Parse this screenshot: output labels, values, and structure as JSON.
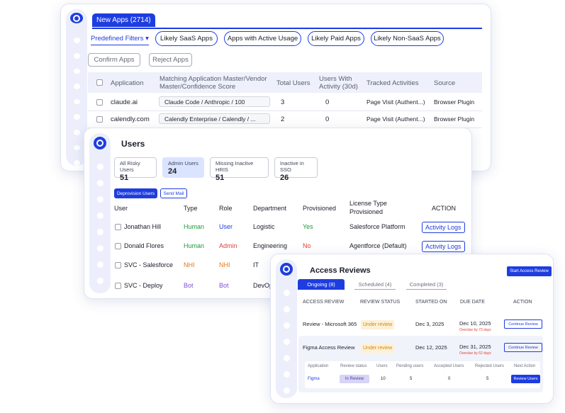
{
  "colors": {
    "accent": "#1e3de0",
    "human": "#1f9a3c",
    "nhi": "#e07b13",
    "bot": "#7d4fd8",
    "admin": "#e2413b",
    "user": "#1e3de0",
    "warning_bg": "#fdf0d6"
  },
  "apps": {
    "tab_label": "New Apps (2714)",
    "predefined_filters": "Predefined Filters ▾",
    "pills": [
      "Likely SaaS Apps",
      "Apps with Active Usage",
      "Likely Paid Apps",
      "Likely Non-SaaS Apps"
    ],
    "confirm_button": "Confirm Apps",
    "reject_button": "Reject Apps",
    "columns": [
      "Application",
      "Matching Application Master/Vendor Master/Confidence Score",
      "Total Users",
      "Users With Activity (30d)",
      "Tracked Activities",
      "Source"
    ],
    "rows": [
      {
        "application": "claude.ai",
        "matching": "Claude Code / Anthropic / 100",
        "total_users": "3",
        "active_users": "0",
        "tracked": "Page Visit (Authent...)",
        "source": "Browser Plugin"
      },
      {
        "application": "calendly.com",
        "matching": "Calendly Enterprise / Calendly / ...",
        "total_users": "2",
        "active_users": "0",
        "tracked": "Page Visit (Authent...)",
        "source": "Browser Plugin"
      }
    ]
  },
  "users": {
    "title": "Users",
    "stats": [
      {
        "label": "All Risky Users",
        "value": "51"
      },
      {
        "label": "Admin Users",
        "value": "24"
      },
      {
        "label": "Missing Inactive HRIS",
        "value": "51"
      },
      {
        "label": "Inactive in SSO",
        "value": "26"
      }
    ],
    "deprovision_button": "Deprovision Users",
    "send_mail_button": "Send Mail",
    "columns": {
      "user": "User",
      "type": "Type",
      "role": "Role",
      "department": "Department",
      "provisioned": "Provisioned",
      "license": "License Type Provisioned",
      "action": "ACTION"
    },
    "rows": [
      {
        "name": "Jonathan Hill",
        "type": "Human",
        "role": "User",
        "department": "Logistic",
        "provisioned": "Yes",
        "license": "Salesforce Platform",
        "action": "Activity Logs"
      },
      {
        "name": "Donald Flores",
        "type": "Human",
        "role": "Admin",
        "department": "Engineering",
        "provisioned": "No",
        "license": "Agentforce (Default)",
        "action": "Activity Logs"
      },
      {
        "name": "SVC - Salesforce",
        "type": "NHI",
        "role": "NHI",
        "department": "IT"
      },
      {
        "name": "SVC - Deploy",
        "type": "Bot",
        "role": "Bot",
        "department": "DevOp"
      }
    ]
  },
  "access_reviews": {
    "title": "Access Reviews",
    "start_button": "Start Access Review",
    "tabs": [
      "Ongoing (8)",
      "Scheduled (4)",
      "Completed (3)"
    ],
    "columns": [
      "ACCESS REVIEW",
      "REVIEW STATUS",
      "STARTED ON",
      "DUE DATE",
      "ACTION"
    ],
    "rows": [
      {
        "name": "Review - Microsoft 365",
        "status": "Under review",
        "started": "Dec 3, 2025",
        "due": "Dec 10, 2025",
        "overdue": "Overdue by 73 days",
        "action": "Continue Review"
      },
      {
        "name": "Figma Access Review",
        "status": "Under review",
        "started": "Dec 12, 2025",
        "due": "Dec 31, 2025",
        "overdue": "Overdue by 52 days",
        "action": "Continue Review"
      }
    ],
    "sub_columns": [
      "Application",
      "Review status",
      "Users",
      "Pending users",
      "Accepted Users",
      "Rejected Users",
      "Next Action"
    ],
    "sub_row": {
      "application": "Figma",
      "status": "In Review",
      "users": "10",
      "pending": "5",
      "accepted": "0",
      "rejected": "5",
      "next_action": "Review Users"
    }
  }
}
